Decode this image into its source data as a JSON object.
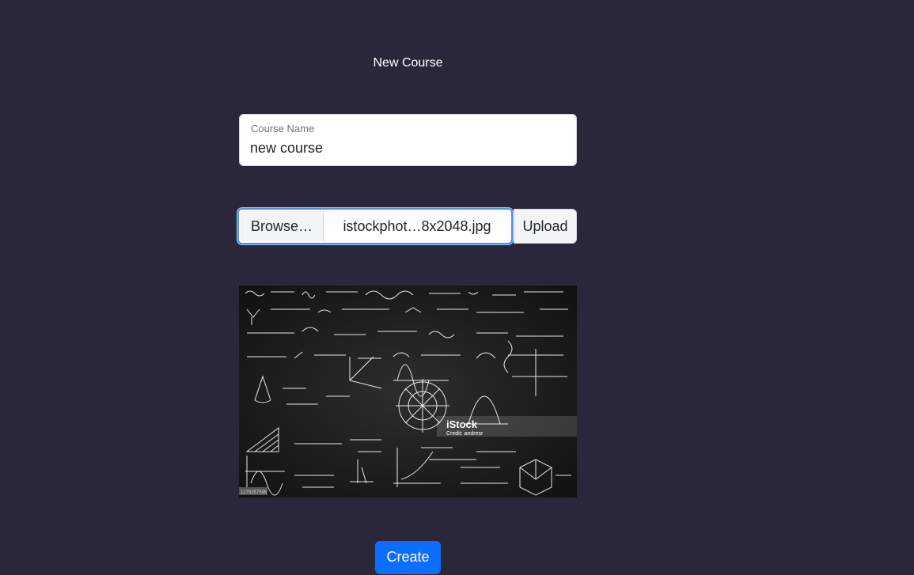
{
  "page": {
    "title": "New Course"
  },
  "course_name": {
    "label": "Course Name",
    "value": "new course"
  },
  "file_upload": {
    "browse_label": "Browse…",
    "file_name": "istockphot…8x2048.jpg",
    "upload_label": "Upload"
  },
  "preview": {
    "watermark_brand": "iStock",
    "watermark_credit": "Credit: andresr",
    "corner_id": "1279257595",
    "description": "chalkboard-math-formulas-image"
  },
  "actions": {
    "create_label": "Create"
  },
  "colors": {
    "background": "#2a273b",
    "primary": "#0d6efd",
    "focus_border": "#4b8fe6"
  }
}
